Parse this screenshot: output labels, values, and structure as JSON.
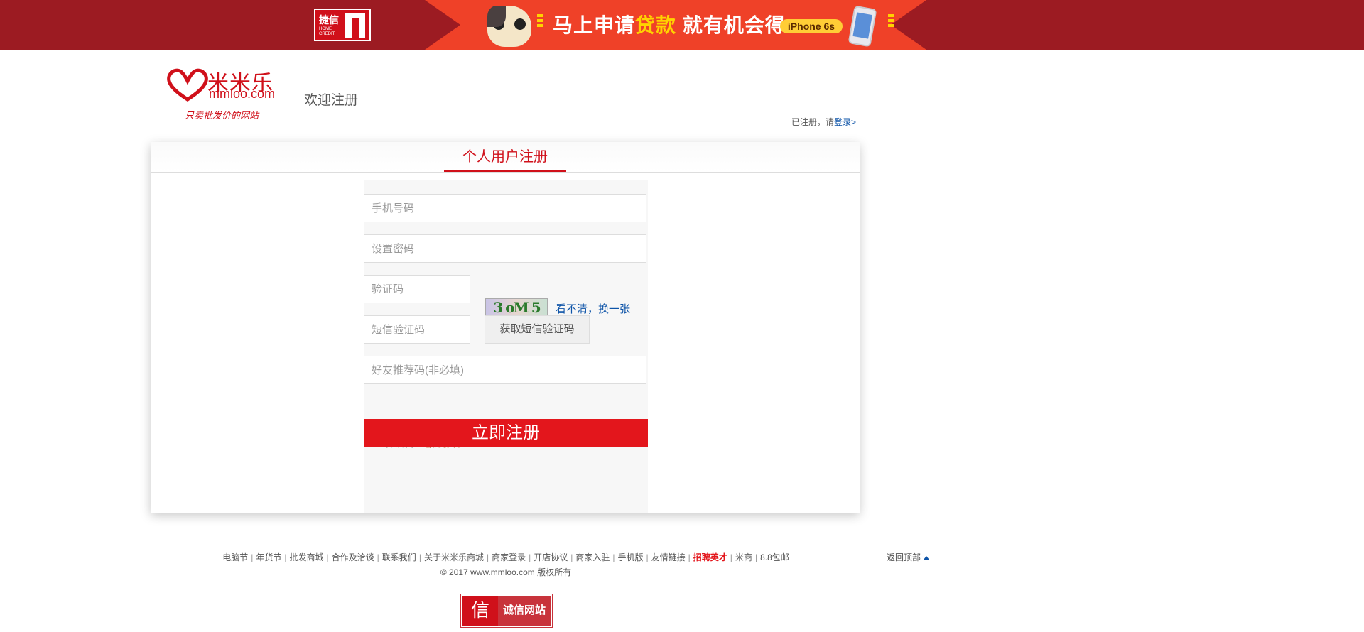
{
  "banner": {
    "home_credit_cn": "捷信",
    "home_credit_en": "HOME CREDIT",
    "slogan_part1": "马上申请",
    "slogan_highlight": "贷款",
    "slogan_part2": " 就有机会得",
    "prize": "iPhone 6s",
    "colors": {
      "background": "#9c1b22",
      "center": "#ef4128",
      "accent": "#ffd200"
    }
  },
  "header": {
    "logo_cn": "米米乐",
    "logo_en": "mmloo.com",
    "logo_slogan": "只卖批发价的网站",
    "welcome": "欢迎注册",
    "registered_hint": "已注册，请",
    "login_link": "登录>"
  },
  "form": {
    "tab_title": "个人用户注册",
    "phone_placeholder": "手机号码",
    "password_placeholder": "设置密码",
    "captcha_placeholder": "验证码",
    "captcha_text": "3 oM 5",
    "captcha_refresh": "看不清，换一张",
    "sms_placeholder": "短信验证码",
    "sms_button": "获取短信验证码",
    "referral_placeholder": "好友推荐码(非必填)",
    "agree_checked": true,
    "agree_text": "阅读并同意",
    "agree_link": "服务协议",
    "submit": "立即注册",
    "colors": {
      "accent": "#e3161c",
      "link": "#0e54a8"
    }
  },
  "footer": {
    "links": [
      {
        "label": "电脑节",
        "hot": false
      },
      {
        "label": "年货节",
        "hot": false
      },
      {
        "label": "批发商城",
        "hot": false
      },
      {
        "label": "合作及洽谈",
        "hot": false
      },
      {
        "label": "联系我们",
        "hot": false
      },
      {
        "label": "关于米米乐商城",
        "hot": false
      },
      {
        "label": "商家登录",
        "hot": false
      },
      {
        "label": "开店协议",
        "hot": false
      },
      {
        "label": "商家入驻",
        "hot": false
      },
      {
        "label": "手机版",
        "hot": false
      },
      {
        "label": "友情链接",
        "hot": false
      },
      {
        "label": "招聘英才",
        "hot": true
      },
      {
        "label": "米商",
        "hot": false
      },
      {
        "label": "8.8包邮",
        "hot": false
      }
    ],
    "copyright": "© 2017 www.mmloo.com 版权所有",
    "back_to_top": "返回顶部",
    "trust_icon": "信",
    "trust_label": "诚信网站"
  }
}
